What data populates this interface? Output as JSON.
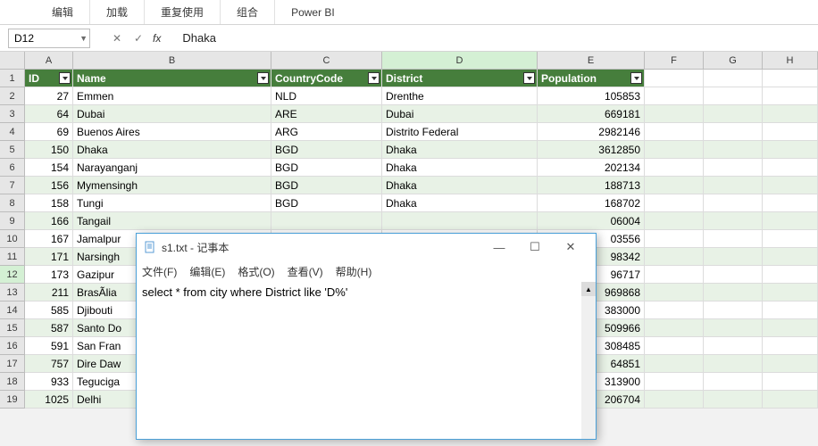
{
  "ribbon": {
    "tabs": [
      "编辑",
      "加载",
      "重复使用",
      "组合",
      "Power BI"
    ]
  },
  "namebox": "D12",
  "formula": "Dhaka",
  "columns": [
    "A",
    "B",
    "C",
    "D",
    "E",
    "F",
    "G",
    "H"
  ],
  "active_col_index": 3,
  "active_row": 12,
  "header_row": {
    "id": "ID",
    "name": "Name",
    "country": "CountryCode",
    "district": "District",
    "population": "Population"
  },
  "rows": [
    {
      "r": 2,
      "id": 27,
      "name": "Emmen",
      "country": "NLD",
      "district": "Drenthe",
      "population": 105853
    },
    {
      "r": 3,
      "id": 64,
      "name": "Dubai",
      "country": "ARE",
      "district": "Dubai",
      "population": 669181
    },
    {
      "r": 4,
      "id": 69,
      "name": "Buenos Aires",
      "country": "ARG",
      "district": "Distrito Federal",
      "population": 2982146
    },
    {
      "r": 5,
      "id": 150,
      "name": "Dhaka",
      "country": "BGD",
      "district": "Dhaka",
      "population": 3612850
    },
    {
      "r": 6,
      "id": 154,
      "name": "Narayanganj",
      "country": "BGD",
      "district": "Dhaka",
      "population": 202134
    },
    {
      "r": 7,
      "id": 156,
      "name": "Mymensingh",
      "country": "BGD",
      "district": "Dhaka",
      "population": 188713
    },
    {
      "r": 8,
      "id": 158,
      "name": "Tungi",
      "country": "BGD",
      "district": "Dhaka",
      "population": 168702
    },
    {
      "r": 9,
      "id": 166,
      "name": "Tangail",
      "country": "",
      "district": "",
      "population": "06004"
    },
    {
      "r": 10,
      "id": 167,
      "name": "Jamalpur",
      "country": "",
      "district": "",
      "population": "03556"
    },
    {
      "r": 11,
      "id": 171,
      "name": "Narsingh",
      "country": "",
      "district": "",
      "population": "98342"
    },
    {
      "r": 12,
      "id": 173,
      "name": "Gazipur",
      "country": "",
      "district": "",
      "population": "96717"
    },
    {
      "r": 13,
      "id": 211,
      "name": "BrasÃ­lia",
      "country": "",
      "district": "",
      "population": "969868"
    },
    {
      "r": 14,
      "id": 585,
      "name": "Djibouti",
      "country": "",
      "district": "",
      "population": "383000"
    },
    {
      "r": 15,
      "id": 587,
      "name": "Santo Do",
      "country": "",
      "district": "",
      "population": "509966"
    },
    {
      "r": 16,
      "id": 591,
      "name": "San Fran",
      "country": "",
      "district": "",
      "population": "308485"
    },
    {
      "r": 17,
      "id": 757,
      "name": "Dire Daw",
      "country": "",
      "district": "",
      "population": "64851"
    },
    {
      "r": 18,
      "id": 933,
      "name": "Teguciga",
      "country": "",
      "district": "",
      "population": "313900"
    },
    {
      "r": 19,
      "id": 1025,
      "name": "Delhi",
      "country": "",
      "district": "",
      "population": "206704"
    }
  ],
  "notepad": {
    "title": "s1.txt - 记事本",
    "menus": [
      "文件(F)",
      "编辑(E)",
      "格式(O)",
      "查看(V)",
      "帮助(H)"
    ],
    "content": "select * from city where District like 'D%'"
  }
}
